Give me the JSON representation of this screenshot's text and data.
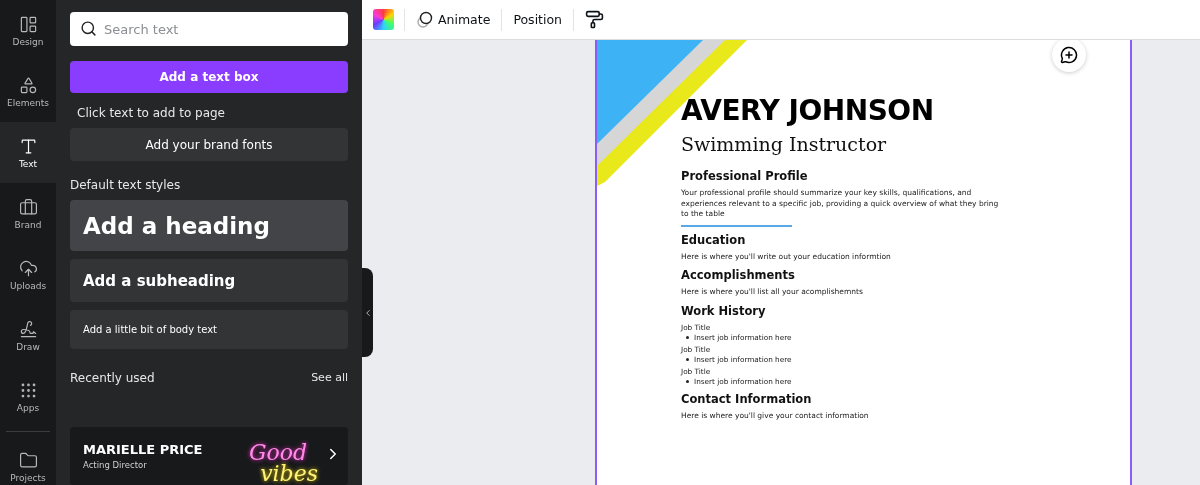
{
  "nav": [
    {
      "label": "Design",
      "selected": false
    },
    {
      "label": "Elements",
      "selected": false
    },
    {
      "label": "Text",
      "selected": true
    },
    {
      "label": "Brand",
      "selected": false
    },
    {
      "label": "Uploads",
      "selected": false
    },
    {
      "label": "Draw",
      "selected": false
    },
    {
      "label": "Apps",
      "selected": false
    },
    {
      "label": "Projects",
      "selected": false
    }
  ],
  "panel": {
    "search": {
      "placeholder": "Search text"
    },
    "add_button": "Add a text box",
    "hint": "Click text to add to page",
    "brand_fonts_button": "Add your brand fonts",
    "styles_heading": "Default text styles",
    "styles": [
      {
        "kind": "heading",
        "label": "Add a heading"
      },
      {
        "kind": "subheading",
        "label": "Add a subheading"
      },
      {
        "kind": "body",
        "label": "Add a little bit of body text"
      }
    ],
    "recent": {
      "heading": "Recently used",
      "see_all": "See all",
      "item": {
        "name": "MARIELLE PRICE",
        "role": "Acting Director",
        "neon": [
          "Good",
          "vibes"
        ]
      }
    }
  },
  "toolbar": {
    "animate": "Animate",
    "position": "Position"
  },
  "resume": {
    "name": "AVERY JOHNSON",
    "title": "Swimming Instructor",
    "sections": [
      {
        "kind": "text",
        "heading": "Professional Profile",
        "body": "Your professional profile should summarize your key skills, qualifications, and experiences relevant to a specific job, providing a quick overview of what they bring to the table",
        "rule": true
      },
      {
        "kind": "text",
        "heading": "Education",
        "body": "Here is where you'll write out your education informtion",
        "rule": false
      },
      {
        "kind": "text",
        "heading": "Accomplishments",
        "body": "Here is where you'll list all your acomplishemnts",
        "rule": false
      },
      {
        "kind": "jobs",
        "heading": "Work History",
        "jobs": [
          {
            "title": "Job Title",
            "bullet": "Insert job information here"
          },
          {
            "title": "Job Title",
            "bullet": "Insert job information here"
          },
          {
            "title": "Job Title",
            "bullet": "Insert job information here"
          }
        ]
      },
      {
        "kind": "text",
        "heading": "Contact Information",
        "body": "Here is where you'll give your contact information",
        "rule": false
      }
    ]
  }
}
